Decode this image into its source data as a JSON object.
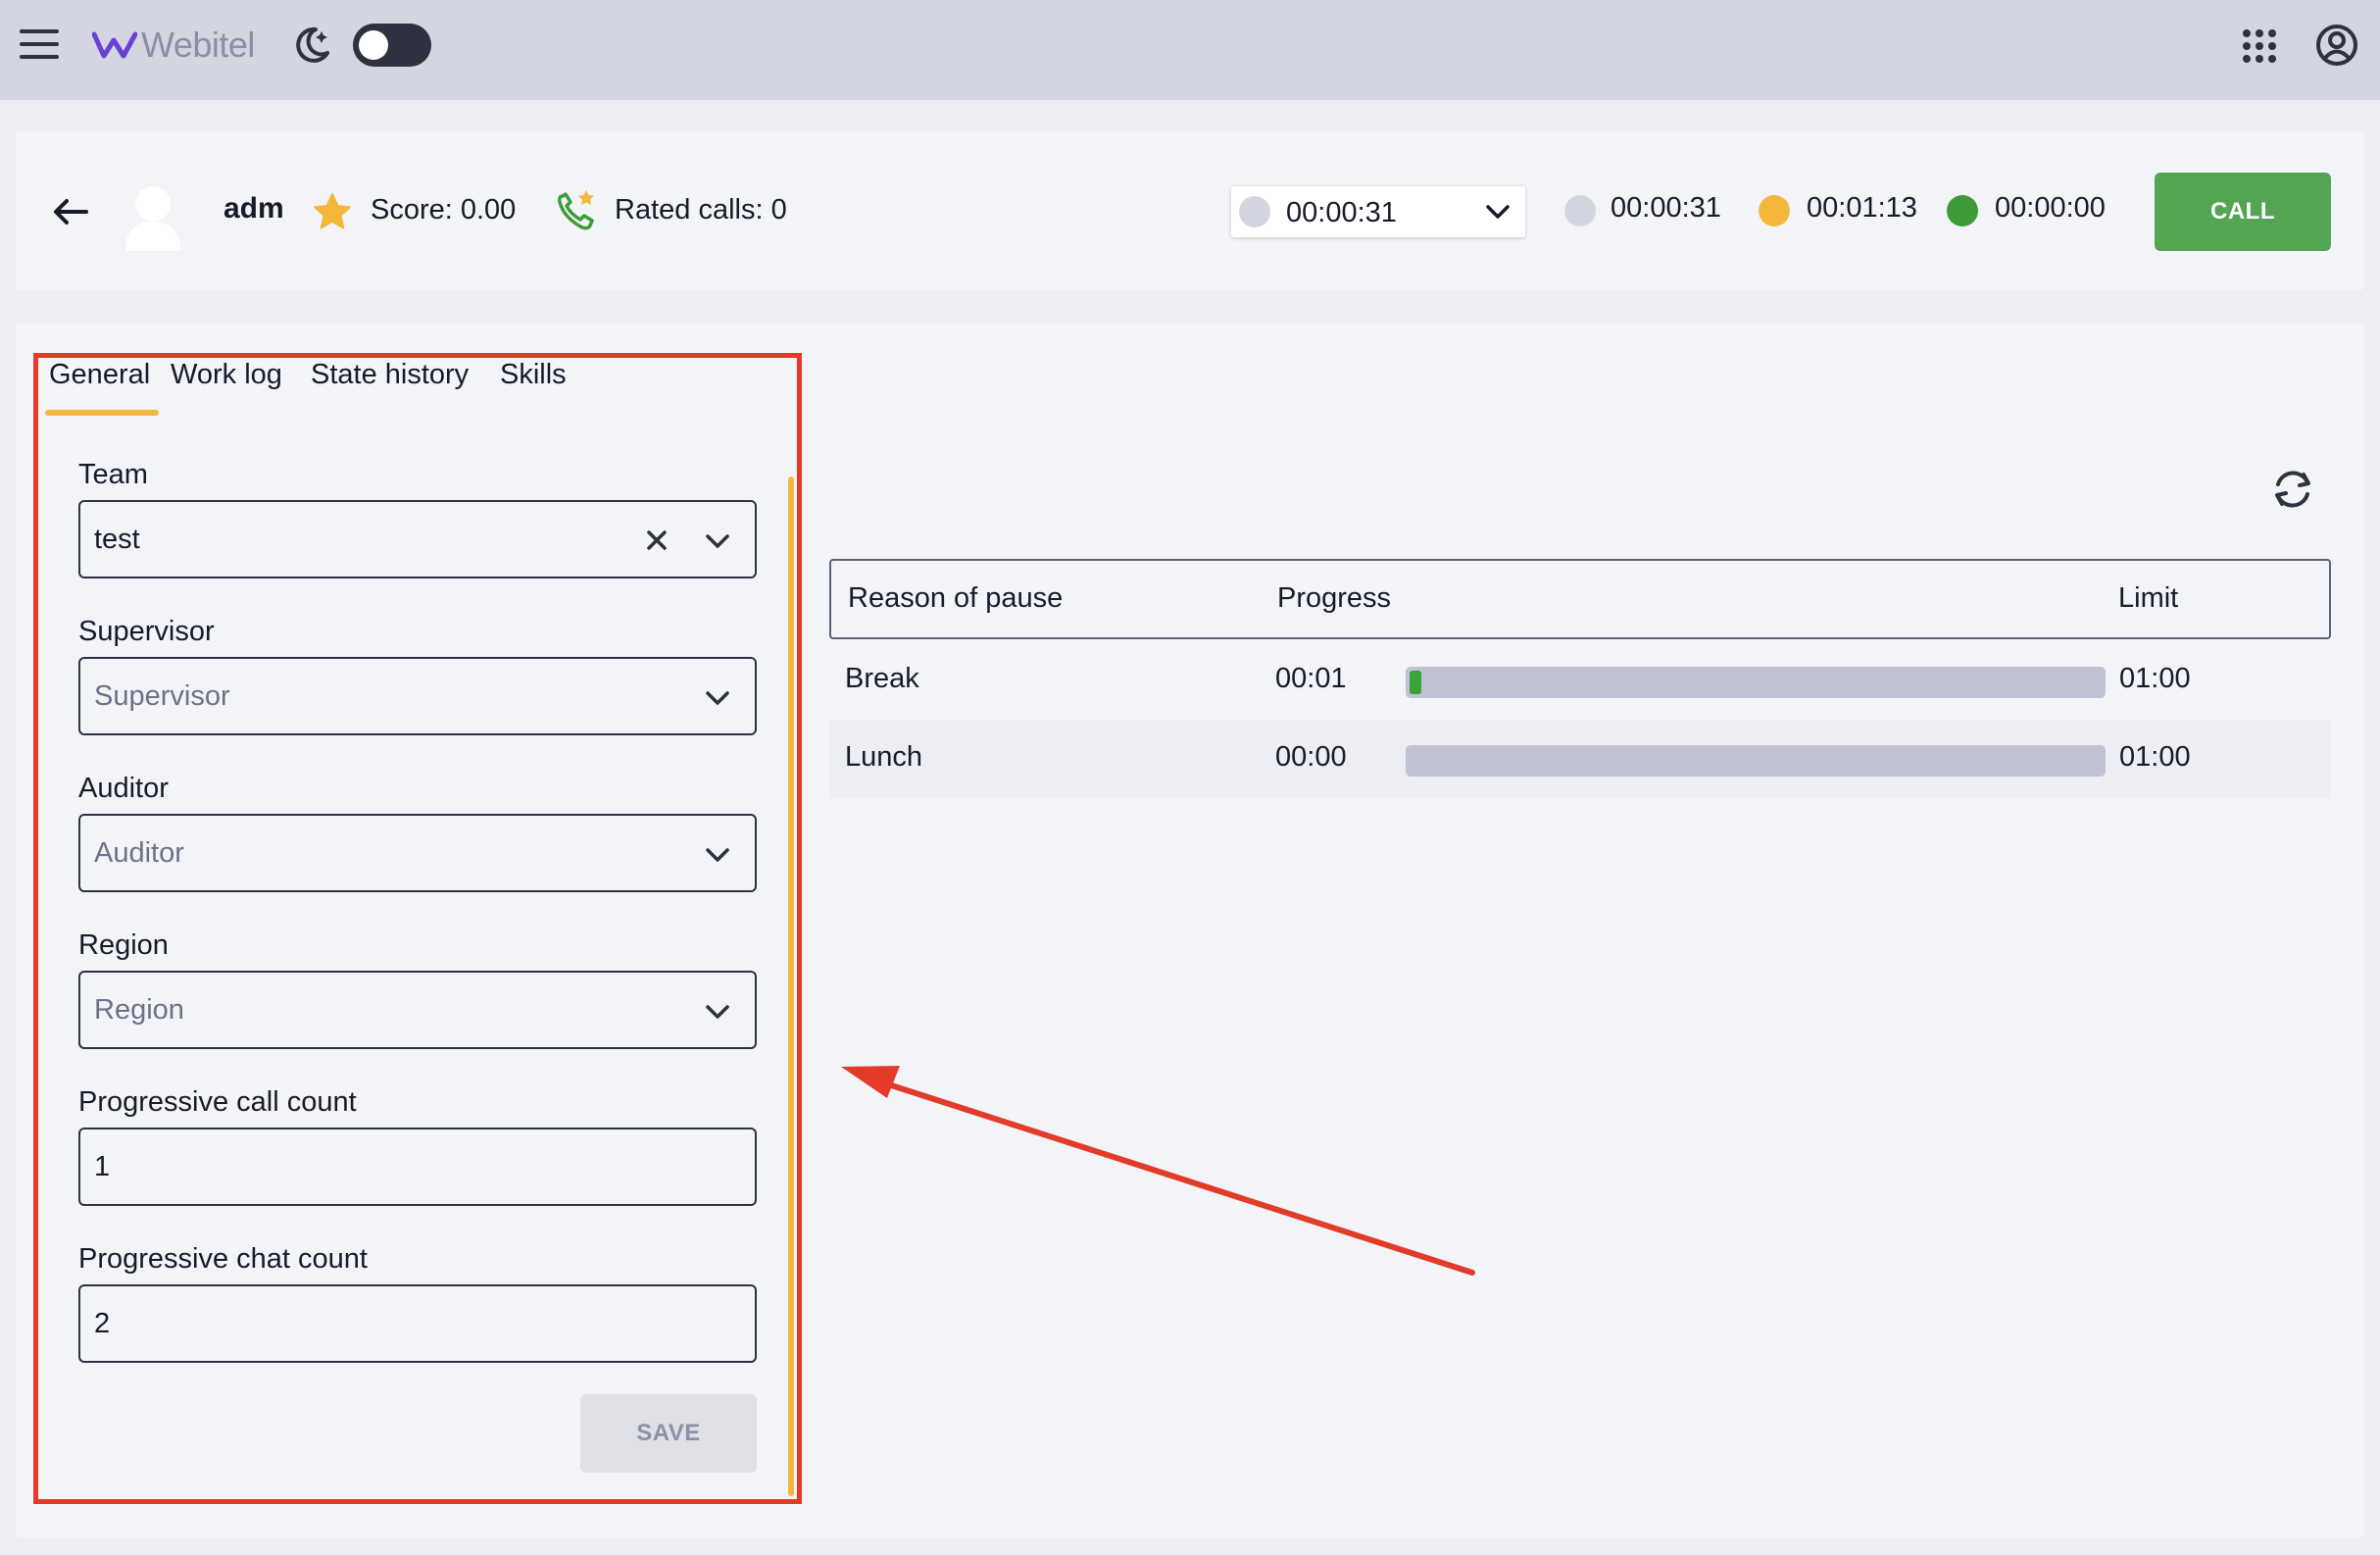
{
  "app": {
    "logo_text": "Webitel",
    "theme_toggle_on": false,
    "icons": [
      "hamburger-icon",
      "webitel-logo-icon",
      "dark-mode-icon",
      "apps-grid-icon",
      "account-icon"
    ]
  },
  "agent": {
    "name": "adm",
    "score_text": "Score: 0.00",
    "rated_calls_text": "Rated calls: 0",
    "status_select_time": "00:00:31",
    "timers": [
      {
        "label": "00:00:31",
        "color": "#d3d6e0"
      },
      {
        "label": "00:01:13",
        "color": "#f4b73b"
      },
      {
        "label": "00:00:00",
        "color": "#3f9b3a"
      }
    ],
    "call_label": "CALL",
    "call_color": "#54a553"
  },
  "tabs": [
    {
      "label": "General",
      "active": true
    },
    {
      "label": "Work log",
      "active": false
    },
    {
      "label": "State history",
      "active": false
    },
    {
      "label": "Skills",
      "active": false
    }
  ],
  "form": {
    "team": {
      "label": "Team",
      "value": "test"
    },
    "supervisor": {
      "label": "Supervisor",
      "placeholder": "Supervisor"
    },
    "auditor": {
      "label": "Auditor",
      "placeholder": "Auditor"
    },
    "region": {
      "label": "Region",
      "placeholder": "Region"
    },
    "progressive_call_count": {
      "label": "Progressive call count",
      "value": "1"
    },
    "progressive_chat_count": {
      "label": "Progressive chat count",
      "value": "2"
    },
    "save_label": "SAVE"
  },
  "pause_table": {
    "headers": [
      "Reason of pause",
      "Progress",
      "Limit"
    ],
    "rows": [
      {
        "reason": "Break",
        "progress": "00:01",
        "limit": "01:00",
        "fraction": 0.017
      },
      {
        "reason": "Lunch",
        "progress": "00:00",
        "limit": "01:00",
        "fraction": 0.0
      }
    ]
  },
  "annotation": {
    "highlight_color": "#e23b2a"
  }
}
